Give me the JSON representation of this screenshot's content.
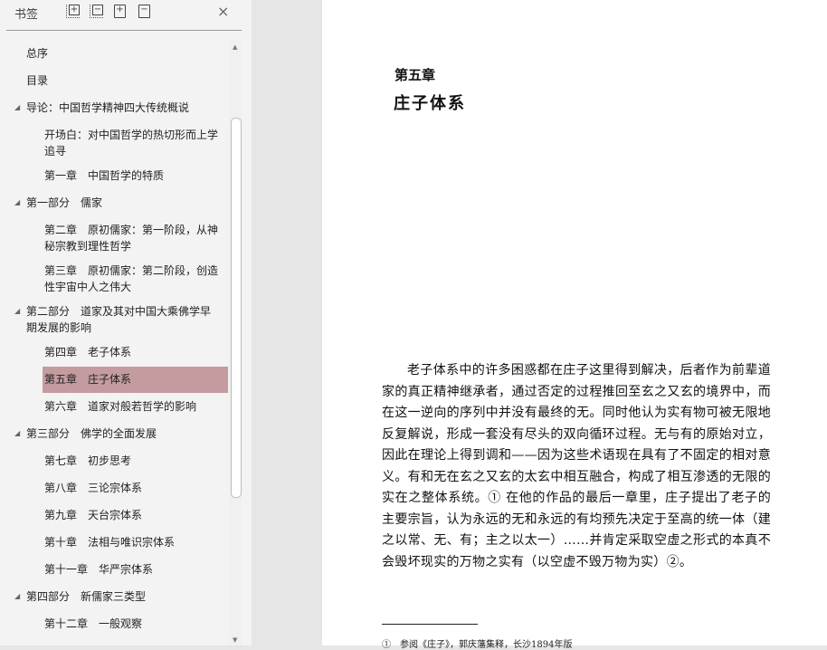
{
  "sidebar": {
    "title": "书签",
    "close": "×",
    "tools": [
      "expand-all",
      "collapse-all",
      "add-bookmark",
      "delete-bookmark"
    ],
    "items": [
      {
        "label": "总序",
        "level": 1
      },
      {
        "label": "目录",
        "level": 1
      },
      {
        "label": "导论：中国哲学精神四大传统概说",
        "level": 1,
        "expanded": true
      },
      {
        "label": "开场白：对中国哲学的热切形而上学追寻",
        "level": 2
      },
      {
        "label": "第一章　中国哲学的特质",
        "level": 2
      },
      {
        "label": "第一部分　儒家",
        "level": 1,
        "expanded": true
      },
      {
        "label": "第二章　原初儒家：第一阶段，从神秘宗教到理性哲学",
        "level": 2
      },
      {
        "label": "第三章　原初儒家：第二阶段，创造性宇宙中人之伟大",
        "level": 2
      },
      {
        "label": "第二部分　道家及其对中国大乘佛学早期发展的影响",
        "level": 1,
        "expanded": true
      },
      {
        "label": "第四章　老子体系",
        "level": 2
      },
      {
        "label": "第五章　庄子体系",
        "level": 2,
        "selected": true
      },
      {
        "label": "第六章　道家对般若哲学的影响",
        "level": 2
      },
      {
        "label": "第三部分　佛学的全面发展",
        "level": 1,
        "expanded": true
      },
      {
        "label": "第七章　初步思考",
        "level": 2
      },
      {
        "label": "第八章　三论宗体系",
        "level": 2
      },
      {
        "label": "第九章　天台宗体系",
        "level": 2
      },
      {
        "label": "第十章　法相与唯识宗体系",
        "level": 2
      },
      {
        "label": "第十一章　华严宗体系",
        "level": 2
      },
      {
        "label": "第四部分　新儒家三类型",
        "level": 1,
        "expanded": true
      },
      {
        "label": "第十二章　一般观察",
        "level": 2
      }
    ]
  },
  "page": {
    "chapter_no": "第五章",
    "chapter_title": "庄子体系",
    "body": "老子体系中的许多困惑都在庄子这里得到解决，后者作为前辈道家的真正精神继承者，通过否定的过程推回至玄之又玄的境界中，而在这一逆向的序列中并没有最终的无。同时他认为实有物可被无限地反复解说，形成一套没有尽头的双向循环过程。无与有的原始对立，因此在理论上得到调和——因为这些术语现在具有了不固定的相对意义。有和无在玄之又玄的太玄中相互融合，构成了相互渗透的无限的实在之整体系统。① 在他的作品的最后一章里，庄子提出了老子的主要宗旨，认为永远的无和永远的有均预先决定于至高的统一体（建之以常、无、有；主之以太一）……并肯定采取空虚之形式的本真不会毁坏现实的万物之实有（以空虚不毁万物为实）②。",
    "footnote": "①　参阅《庄子》，郭庆藩集释，长沙1894年版"
  },
  "colors": {
    "selected": "#c49ca0",
    "sidebar": "#f3f3f3"
  }
}
